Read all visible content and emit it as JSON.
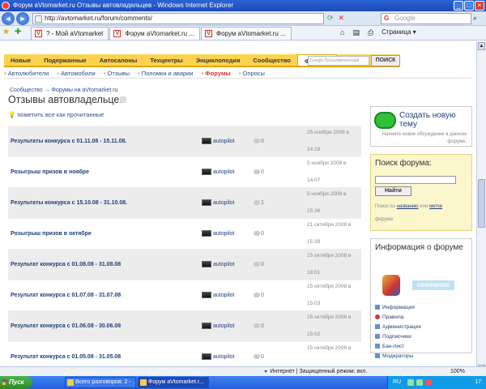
{
  "window": {
    "title": "Форум aVtomarket.ru Отзывы автовладельцев - Windows Internet Explorer"
  },
  "address_bar": {
    "url": "http://avtomarket.ru/forum/comments/",
    "search_placeholder": "Google"
  },
  "browser_tabs": [
    {
      "label": "? - Мой aVtomarket",
      "active": false
    },
    {
      "label": "Форум aVtomarket.ru ...",
      "active": true
    },
    {
      "label": "Форум aVtomarket.ru ...",
      "active": false
    }
  ],
  "toolbar": {
    "page_label": "Страница"
  },
  "site_nav": {
    "items": [
      "Новые",
      "Подержанные",
      "Автосалоны",
      "Техцентры",
      "Энциклопедия",
      "Сообщество",
      "Форумы"
    ],
    "active_index": 6,
    "search_placeholder": "Google Пользовательский",
    "search_button": "ПОИСК"
  },
  "sub_nav": {
    "items": [
      "Автолюбители",
      "Автомобили",
      "Отзывы",
      "Поломки и аварии",
      "Форумы",
      "Опросы"
    ],
    "active_index": 4
  },
  "breadcrumb": "Сообщество → Форумы на aVtomarket.ru",
  "page_title": "Отзывы автовладельцев",
  "mark_read": "пометить все как прочитанные",
  "topics": [
    {
      "title": "Результаты конкурса с 01.11.08 - 15.11.08.",
      "author": "autopilot",
      "replies": "0",
      "date": "25 ноября 2008 в",
      "time": "14:29"
    },
    {
      "title": "Розыгрыш призов в ноябре",
      "author": "autopilot",
      "replies": "0",
      "date": "5 ноября 2008 в",
      "time": "14:07"
    },
    {
      "title": "Результаты конкурса с 15.10.08 - 31.10.08.",
      "author": "autopilot",
      "replies": "1",
      "date": "5 ноября 2008 в",
      "time": "15:36"
    },
    {
      "title": "Розыгрыш призов в октябре",
      "author": "autopilot",
      "replies": "0",
      "date": "21 октября 2008 в",
      "time": "15:39"
    },
    {
      "title": "Результат конкурса с 01.08.08 - 31.08.08",
      "author": "autopilot",
      "replies": "0",
      "date": "15 октября 2008 в",
      "time": "18:01"
    },
    {
      "title": "Результат конкурса с 01.07.08 - 31.07.08",
      "author": "autopilot",
      "replies": "0",
      "date": "15 октября 2008 в",
      "time": "15:03"
    },
    {
      "title": "Результат конкурса с 01.06.08 - 30.06.08",
      "author": "autopilot",
      "replies": "0",
      "date": "15 октября 2008 в",
      "time": "15:02"
    },
    {
      "title": "Результат конкурса с 01.05.08 - 31.05.08",
      "author": "autopilot",
      "replies": "0",
      "date": "15 октября 2008 в",
      "time": ""
    }
  ],
  "sidebar": {
    "new_topic_title": "Создать новую тему",
    "new_topic_desc": "Начните новое обсуждение в данном форуме.",
    "search_title": "Поиск форума:",
    "search_button": "Найти",
    "search_help_prefix": "Поиск по",
    "search_help_link1": "названию",
    "search_help_or": "или",
    "search_help_link2": "метке",
    "search_help_suffix": "форума",
    "info_title": "Информация о форуме",
    "info_badge": "comments",
    "info_links": [
      "Информация",
      "Правила",
      "Администрация",
      "Подписчики",
      "Бан-лист",
      "Модераторы"
    ]
  },
  "status_bar": {
    "zone": "Интернет | Защищенный режим: вкл.",
    "zoom": "100%"
  },
  "taskbar": {
    "start": "Пуск",
    "items": [
      {
        "label": "Всего разговоров: 2 - ...",
        "active": false
      },
      {
        "label": "Форум aVtomarket.r...",
        "active": true
      }
    ],
    "lang": "RU",
    "clock": "17:"
  },
  "colors": {
    "nav_yellow": "#fcd34f",
    "link_blue": "#1f3f7a",
    "active_red": "#cc3333"
  }
}
